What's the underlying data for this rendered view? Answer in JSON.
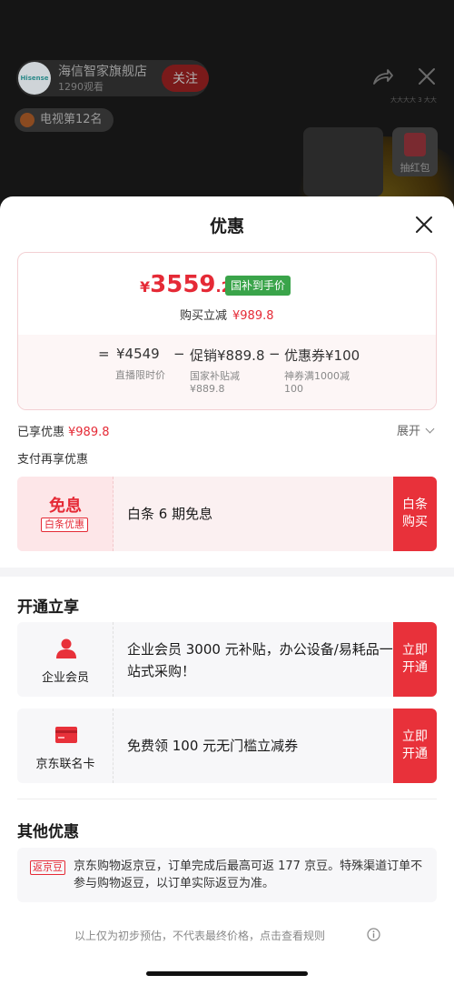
{
  "stream": {
    "store_name": "海信智家旗舰店",
    "viewers": "1290观看",
    "follow_label": "关注",
    "avatar_text": "Hisense",
    "tiny_text": "大大大大 3 大大",
    "rank_badge": "电视第12名",
    "redpack_label": "抽红包"
  },
  "sheet": {
    "title": "优惠",
    "price": {
      "symbol": "¥",
      "integer": "3559",
      "decimal": ".2",
      "tag": "国补到手价",
      "reduce_label": "购买立减",
      "reduce_value": "¥989.8"
    },
    "calc": {
      "eq": "=",
      "base": "¥4549",
      "base_label": "直播限时价",
      "minus1": "−",
      "promo": "促销¥889.8",
      "promo_label_1": "国家补贴减",
      "promo_label_2": "¥889.8",
      "minus2": "−",
      "coupon": "优惠券¥100",
      "coupon_label_1": "神券满1000减",
      "coupon_label_2": "100"
    },
    "enjoyed_label": "已享优惠",
    "enjoyed_value": "¥989.8",
    "expand_label": "展开",
    "pay_more_label": "支付再享优惠",
    "interest_offer": {
      "title": "免息",
      "tag": "白条优惠",
      "desc": "白条 6 期免息",
      "action": "白条\n购买"
    },
    "open_section_title": "开通立享",
    "vip_offer": {
      "label": "企业会员",
      "icon": "person-icon",
      "desc": "企业会员 3000 元补贴，办公设备/易耗品一站式采购！",
      "action": "立即\n开通"
    },
    "jd_card_offer": {
      "label": "京东联名卡",
      "icon": "card-icon",
      "desc": "免费领 100 元无门槛立减券",
      "action": "立即\n开通"
    },
    "other_section_title": "其他优惠",
    "other_offer": {
      "tag": "返京豆",
      "text": "京东购物返京豆，订单完成后最高可返 177 京豆。特殊渠道订单不参与购物返豆，以订单实际返豆为准。"
    },
    "footer_note": "以上仅为初步预估，不代表最终价格，点击查看规则"
  },
  "colors": {
    "accent_red": "#e52a36",
    "action_red": "#e8313a",
    "subsidy_green": "#3aa44a"
  }
}
